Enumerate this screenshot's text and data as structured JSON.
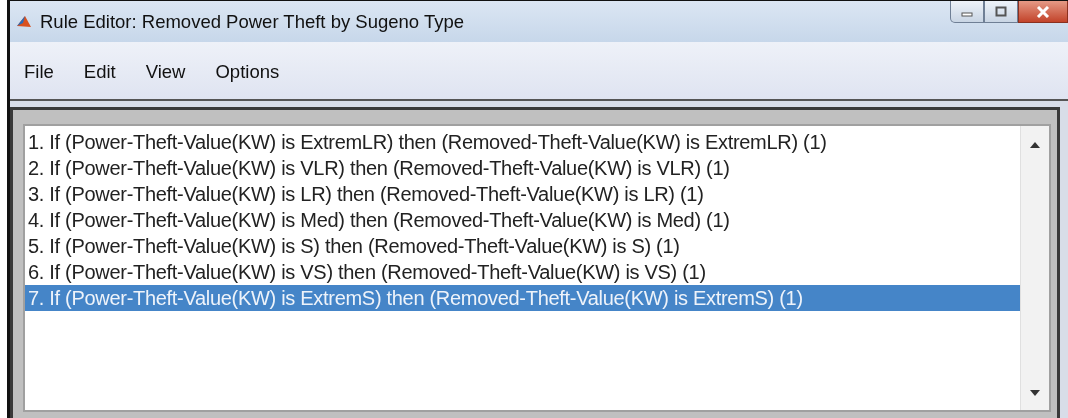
{
  "window": {
    "title": "Rule Editor: Removed Power Theft by Sugeno Type"
  },
  "menu": [
    {
      "label": "File"
    },
    {
      "label": "Edit"
    },
    {
      "label": "View"
    },
    {
      "label": "Options"
    }
  ],
  "rules": [
    {
      "text": "1. If (Power-Theft-Value(KW) is ExtremLR) then (Removed-Theft-Value(KW) is ExtremLR) (1)",
      "selected": false
    },
    {
      "text": "2. If (Power-Theft-Value(KW) is VLR) then (Removed-Theft-Value(KW) is VLR) (1)",
      "selected": false
    },
    {
      "text": "3. If (Power-Theft-Value(KW) is LR) then (Removed-Theft-Value(KW) is LR) (1)",
      "selected": false
    },
    {
      "text": "4. If (Power-Theft-Value(KW) is Med) then (Removed-Theft-Value(KW) is Med) (1)",
      "selected": false
    },
    {
      "text": "5. If (Power-Theft-Value(KW) is S) then (Removed-Theft-Value(KW) is S) (1)",
      "selected": false
    },
    {
      "text": "6. If (Power-Theft-Value(KW) is VS) then (Removed-Theft-Value(KW) is VS) (1)",
      "selected": false
    },
    {
      "text": "7. If (Power-Theft-Value(KW) is ExtremS) then (Removed-Theft-Value(KW) is ExtremS) (1)",
      "selected": true
    }
  ]
}
